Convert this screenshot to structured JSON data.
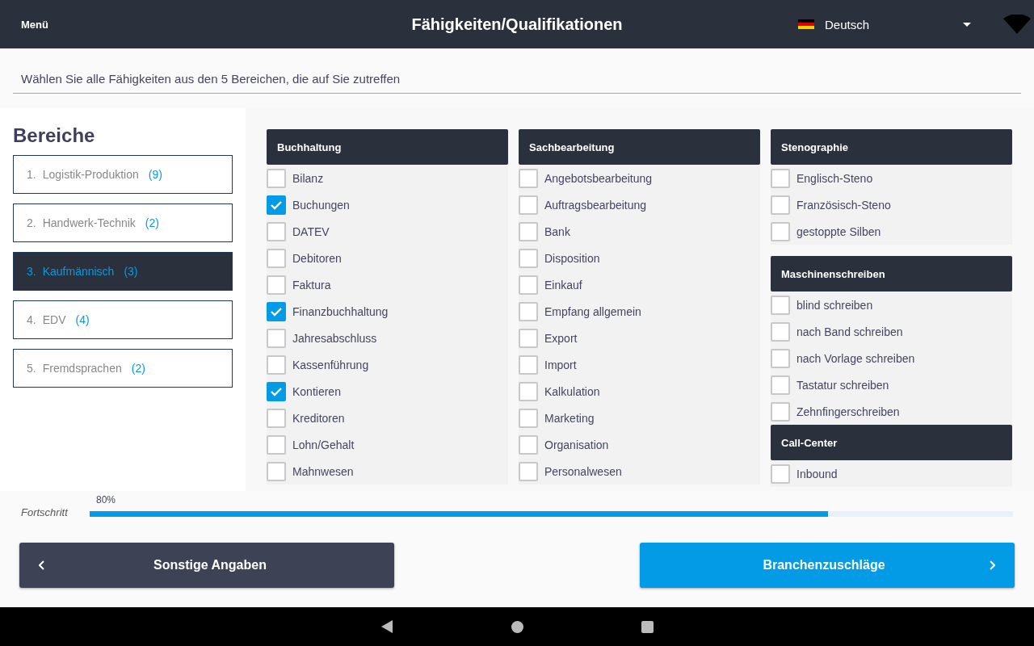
{
  "header": {
    "menu": "Menü",
    "title": "Fähigkeiten/Qualifikationen",
    "language": "Deutsch"
  },
  "instruction": "Wählen Sie alle Fähigkeiten aus den 5 Bereichen, die auf Sie zutreffen",
  "sidebar": {
    "title": "Bereiche",
    "items": [
      {
        "number": "1.",
        "label": "Logistik-Produktion",
        "count": "(9)",
        "selected": false
      },
      {
        "number": "2.",
        "label": "Handwerk-Technik",
        "count": "(2)",
        "selected": false
      },
      {
        "number": "3.",
        "label": "Kaufmännisch",
        "count": "(3)",
        "selected": true
      },
      {
        "number": "4.",
        "label": "EDV",
        "count": "(4)",
        "selected": false
      },
      {
        "number": "5.",
        "label": "Fremdsprachen",
        "count": "(2)",
        "selected": false
      }
    ]
  },
  "columns": [
    {
      "groups": [
        {
          "title": "Buchhaltung",
          "items": [
            {
              "label": "Bilanz",
              "checked": false
            },
            {
              "label": "Buchungen",
              "checked": true
            },
            {
              "label": "DATEV",
              "checked": false
            },
            {
              "label": "Debitoren",
              "checked": false
            },
            {
              "label": "Faktura",
              "checked": false
            },
            {
              "label": "Finanzbuchhaltung",
              "checked": true
            },
            {
              "label": "Jahresabschluss",
              "checked": false
            },
            {
              "label": "Kassenführung",
              "checked": false
            },
            {
              "label": "Kontieren",
              "checked": true
            },
            {
              "label": "Kreditoren",
              "checked": false
            },
            {
              "label": "Lohn/Gehalt",
              "checked": false
            },
            {
              "label": "Mahnwesen",
              "checked": false
            }
          ]
        }
      ]
    },
    {
      "groups": [
        {
          "title": "Sachbearbeitung",
          "items": [
            {
              "label": "Angebotsbearbeitung",
              "checked": false
            },
            {
              "label": "Auftragsbearbeitung",
              "checked": false
            },
            {
              "label": "Bank",
              "checked": false
            },
            {
              "label": "Disposition",
              "checked": false
            },
            {
              "label": "Einkauf",
              "checked": false
            },
            {
              "label": "Empfang allgemein",
              "checked": false
            },
            {
              "label": "Export",
              "checked": false
            },
            {
              "label": "Import",
              "checked": false
            },
            {
              "label": "Kalkulation",
              "checked": false
            },
            {
              "label": "Marketing",
              "checked": false
            },
            {
              "label": "Organisation",
              "checked": false
            },
            {
              "label": "Personalwesen",
              "checked": false
            }
          ]
        }
      ]
    },
    {
      "groups": [
        {
          "title": "Stenographie",
          "items": [
            {
              "label": "Englisch-Steno",
              "checked": false
            },
            {
              "label": "Französisch-Steno",
              "checked": false
            },
            {
              "label": "gestoppte Silben",
              "checked": false
            }
          ]
        },
        {
          "title": "Maschinenschreiben",
          "items": [
            {
              "label": "blind schreiben",
              "checked": false
            },
            {
              "label": "nach Band schreiben",
              "checked": false
            },
            {
              "label": "nach Vorlage schreiben",
              "checked": false
            },
            {
              "label": "Tastatur schreiben",
              "checked": false
            },
            {
              "label": "Zehnfingerschreiben",
              "checked": false
            }
          ]
        },
        {
          "title": "Call-Center",
          "items": [
            {
              "label": "Inbound",
              "checked": false
            }
          ]
        }
      ]
    }
  ],
  "progress": {
    "label": "Fortschritt",
    "reading": "80%",
    "level": 0.8
  },
  "buttons": {
    "back": "Sonstige Angaben",
    "next": "Branchenzuschläge"
  }
}
